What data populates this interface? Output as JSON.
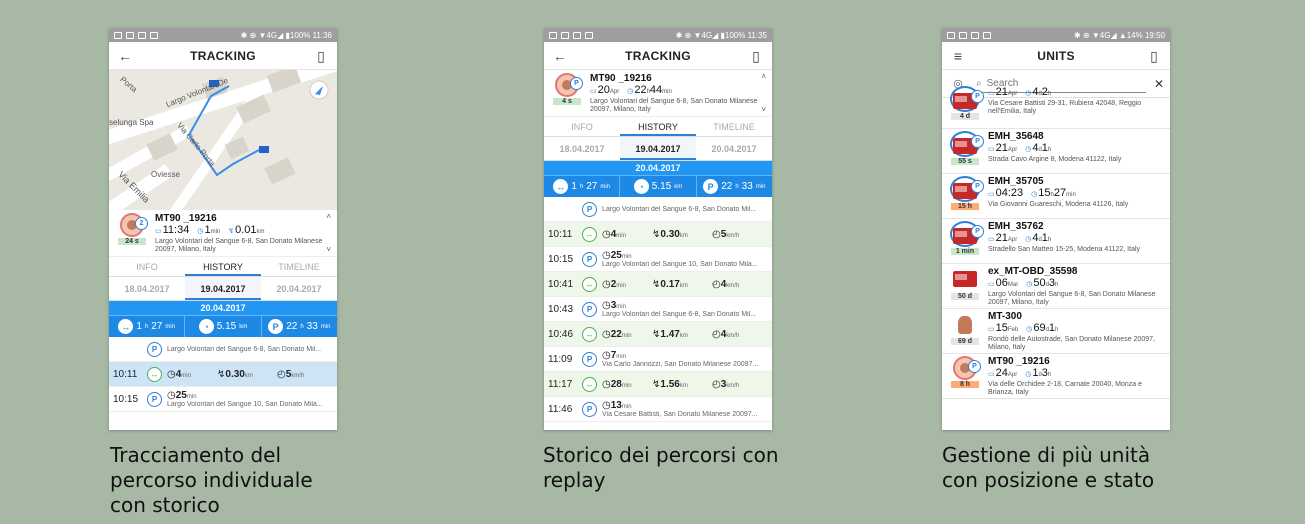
{
  "status_icons": [
    "notification-icon",
    "mail-icon",
    "download-icon",
    "photo-icon"
  ],
  "phone1": {
    "status_right": "✱ ⊕ ▼4G◢ ▮100% 11:36",
    "title": "TRACKING",
    "map_labels": [
      "Porta",
      "Largo Volontari De",
      "selunga Spa",
      "Via Carlo Porta",
      "Oviesse",
      "Via Emilia"
    ],
    "card": {
      "name": "MT90 _19216",
      "time": "11:34",
      "dur": "1",
      "dur_unit": "min",
      "dist": "0.01",
      "dist_unit": "km",
      "addr": "Largo Volontari del Sangue 6-8, San Donato Milanese 20097, Milano, Italy",
      "age": "24 s",
      "badge": "2"
    },
    "tabs": [
      "INFO",
      "HISTORY",
      "TIMELINE"
    ],
    "dates": [
      "18.04.2017",
      "19.04.2017",
      "20.04.2017"
    ],
    "selected_date": "20.04.2017",
    "summary": [
      {
        "a": "1",
        "u1": "h",
        "b": "27",
        "u2": "min"
      },
      {
        "a": "5.15",
        "u1": "km"
      },
      {
        "a": "22",
        "u1": "h",
        "b": "33",
        "u2": "min"
      }
    ],
    "rows": [
      {
        "time": "",
        "icon": "P",
        "v1": "",
        "v2": "",
        "v3": "",
        "addr": "Largo Volontari del Sangue 6-8, San Donato Mil..."
      },
      {
        "time": "10:11",
        "icon": "↔",
        "v1": "4",
        "u1": "min",
        "v2": "0.30",
        "u2": "km",
        "v3": "5",
        "u3": "km/h",
        "addr": ""
      },
      {
        "time": "10:15",
        "icon": "P",
        "v1": "25",
        "u1": "min",
        "v2": "",
        "v3": "",
        "addr": "Largo Volontari del Sangue 10, San Donato Mila..."
      }
    ]
  },
  "phone2": {
    "status_right": "✱ ⊕ ▼4G◢ ▮100% 11:35",
    "title": "TRACKING",
    "card": {
      "name": "MT90 _19216",
      "date": "20",
      "date_unit": "Apr",
      "dur": "22",
      "dur_u1": "h",
      "dur2": "44",
      "dur_u2": "min",
      "addr": "Largo Volontari del Sangue 6-8, San Donato Milanese 20097, Milano, Italy",
      "age": "4 s"
    },
    "tabs": [
      "INFO",
      "HISTORY",
      "TIMELINE"
    ],
    "dates": [
      "18.04.2017",
      "19.04.2017",
      "20.04.2017"
    ],
    "selected_date": "20.04.2017",
    "summary": [
      {
        "a": "1",
        "u1": "h",
        "b": "27",
        "u2": "min"
      },
      {
        "a": "5.15",
        "u1": "km"
      },
      {
        "a": "22",
        "u1": "h",
        "b": "33",
        "u2": "min"
      }
    ],
    "rows": [
      {
        "time": "",
        "icon": "P",
        "addr": "Largo Volontari del Sangue 6-8, San Donato Mil..."
      },
      {
        "time": "10:11",
        "icon": "↔",
        "v1": "4",
        "u1": "min",
        "v2": "0.30",
        "u2": "km",
        "v3": "5",
        "u3": "km/h"
      },
      {
        "time": "10:15",
        "icon": "P",
        "v1": "25",
        "u1": "min",
        "addr": "Largo Volontari del Sangue 10, San Donato Mila..."
      },
      {
        "time": "10:41",
        "icon": "↔",
        "v1": "2",
        "u1": "min",
        "v2": "0.17",
        "u2": "km",
        "v3": "4",
        "u3": "km/h"
      },
      {
        "time": "10:43",
        "icon": "P",
        "v1": "3",
        "u1": "min",
        "addr": "Largo Volontari del Sangue 6-8, San Donato Mil..."
      },
      {
        "time": "10:46",
        "icon": "↔",
        "v1": "22",
        "u1": "min",
        "v2": "1.47",
        "u2": "km",
        "v3": "4",
        "u3": "km/h"
      },
      {
        "time": "11:09",
        "icon": "P",
        "v1": "7",
        "u1": "min",
        "addr": "Via Carlo Jannozzi, San Donato Milanese 20097..."
      },
      {
        "time": "11:17",
        "icon": "↔",
        "v1": "28",
        "u1": "min",
        "v2": "1.56",
        "u2": "km",
        "v3": "3",
        "u3": "km/h"
      },
      {
        "time": "11:46",
        "icon": "P",
        "v1": "13",
        "u1": "min",
        "addr": "Via Cesare Battisti, San Donato Milanese 20097..."
      }
    ]
  },
  "phone3": {
    "status_right": "✱ ⊕ ▼4G◢ ▲14% 19:50",
    "title": "UNITS",
    "search_placeholder": "Search",
    "units": [
      {
        "name": "",
        "d1": "21",
        "d1u": "Apr",
        "d2": "4",
        "d2u": "d",
        "d3": "2",
        "d3u": "h",
        "addr": "Via Cesare Battisti 29-31, Rubiera 42048, Reggio nell'Emilia, Italy",
        "age": "4 d",
        "type": "truck",
        "ac": "gr"
      },
      {
        "name": "EMH_35648",
        "d1": "21",
        "d1u": "Apr",
        "d2": "4",
        "d2u": "d",
        "d3": "1",
        "d3u": "h",
        "addr": "Strada Cavo Argine 8, Modena 41122, Italy",
        "age": "55 s",
        "type": "truck",
        "ac": ""
      },
      {
        "name": "EMH_35705",
        "d1": "04:23",
        "d1u": "",
        "d2": "15",
        "d2u": "h",
        "d3": "27",
        "d3u": "min",
        "addr": "Via Giovanni Guareschi, Modena 41126, Italy",
        "age": "15 h",
        "type": "truck",
        "ac": "or"
      },
      {
        "name": "EMH_35762",
        "d1": "21",
        "d1u": "Apr",
        "d2": "4",
        "d2u": "d",
        "d3": "1",
        "d3u": "h",
        "addr": "Stradello San Matteo 15-25, Modena 41122, Italy",
        "age": "1 min",
        "type": "truck",
        "ac": ""
      },
      {
        "name": "ex_MT-OBD_35598",
        "d1": "06",
        "d1u": "Mar",
        "d2": "50",
        "d2u": "d",
        "d3": "3",
        "d3u": "h",
        "addr": "Largo Volontari del Sangue 6-8, San Donato Milanese 20097, Milano, Italy",
        "age": "50 d",
        "type": "truck2",
        "ac": "gr"
      },
      {
        "name": "MT-300",
        "d1": "15",
        "d1u": "Feb",
        "d2": "69",
        "d2u": "d",
        "d3": "1",
        "d3u": "h",
        "addr": "Rondò delle Autostrade, San Donato Milanese 20097, Milano, Italy",
        "age": "69 d",
        "type": "person",
        "ac": "gr"
      },
      {
        "name": "MT90 _19216",
        "d1": "24",
        "d1u": "Apr",
        "d2": "1",
        "d2u": "d",
        "d3": "3",
        "d3u": "h",
        "addr": "Via delle Orchidee 2-18, Carnate 20040, Monza e Brianza, Italy",
        "age": "8 h",
        "type": "face",
        "ac": "or"
      }
    ]
  },
  "captions": [
    [
      "Tracciamento del",
      "percorso individuale",
      "con storico"
    ],
    [
      "Storico dei percorsi con",
      "replay"
    ],
    [
      "Gestione di più unità",
      "con posizione e stato"
    ]
  ]
}
